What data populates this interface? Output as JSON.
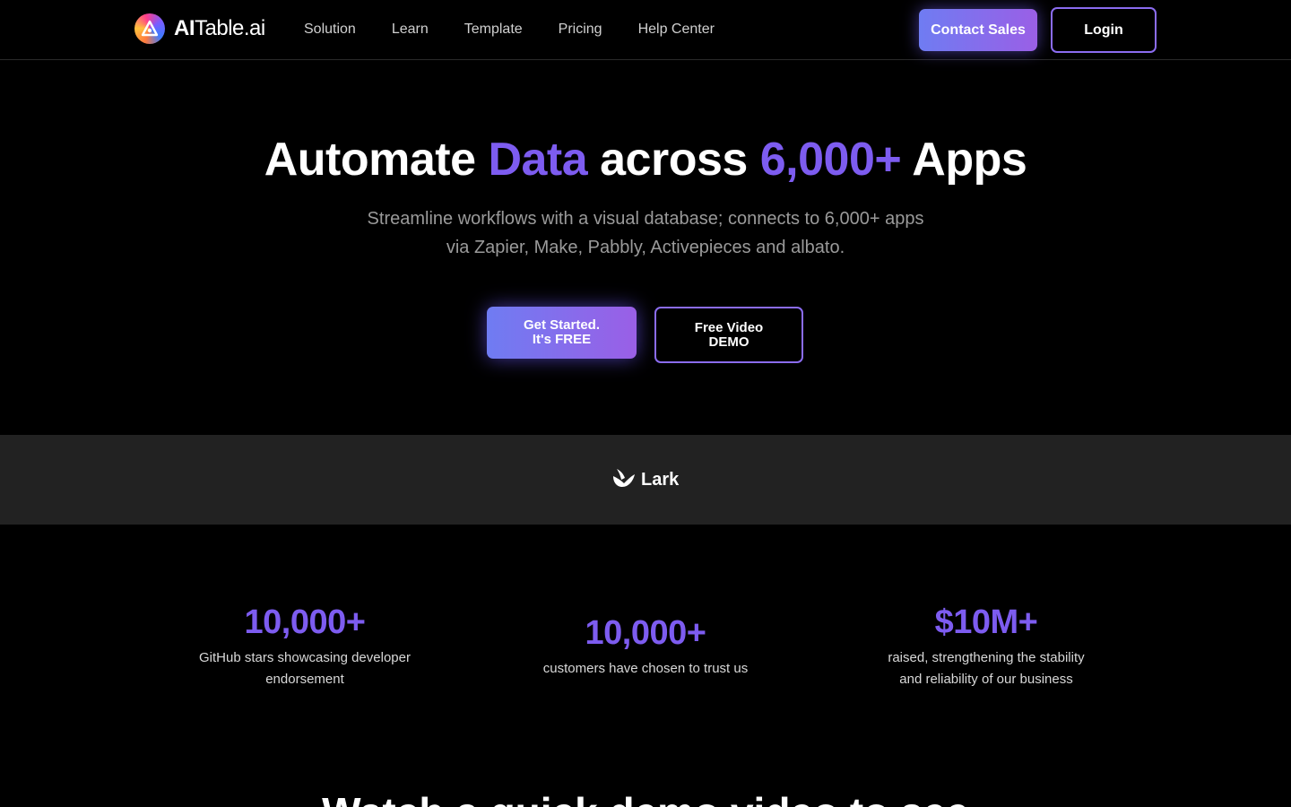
{
  "nav": {
    "logo_text_bold": "AI",
    "logo_text_rest": "Table.ai",
    "logo_icon": "aitable-logo-icon",
    "links": [
      "Solution",
      "Learn",
      "Template",
      "Pricing",
      "Help Center"
    ],
    "contact_label": "Contact Sales",
    "login_label": "Login"
  },
  "hero": {
    "title_part1": "Automate ",
    "title_accent1": "Data",
    "title_part2": " across ",
    "title_accent2": "6,000+",
    "title_part3": " Apps",
    "subtitle_line1": "Streamline workflows with a visual database; connects to 6,000+ apps",
    "subtitle_line2": "via Zapier, Make, Pabbly, Activepieces and albato.",
    "start_line1": "Get Started.",
    "start_line2": "It's FREE",
    "demo_line1": "Free Video",
    "demo_line2": "DEMO"
  },
  "partners": {
    "lark_label": "Lark",
    "lark_icon": "lark-bird-icon"
  },
  "stats": [
    {
      "value": "10,000+",
      "desc_line1": "GitHub stars showcasing developer",
      "desc_line2": "endorsement"
    },
    {
      "value": "10,000+",
      "desc_line1": "customers have chosen to trust us",
      "desc_line2": ""
    },
    {
      "value": "$10M+",
      "desc_line1": "raised, strengthening the stability",
      "desc_line2": "and reliability of our business"
    }
  ],
  "demo_section": {
    "heading": "Watch a quick demo video to see"
  },
  "colors": {
    "accent": "#7d5cf0",
    "button_gradient_start": "#6f7cf2",
    "button_gradient_end": "#9a5fe6",
    "background": "#000000",
    "band": "#222222"
  }
}
